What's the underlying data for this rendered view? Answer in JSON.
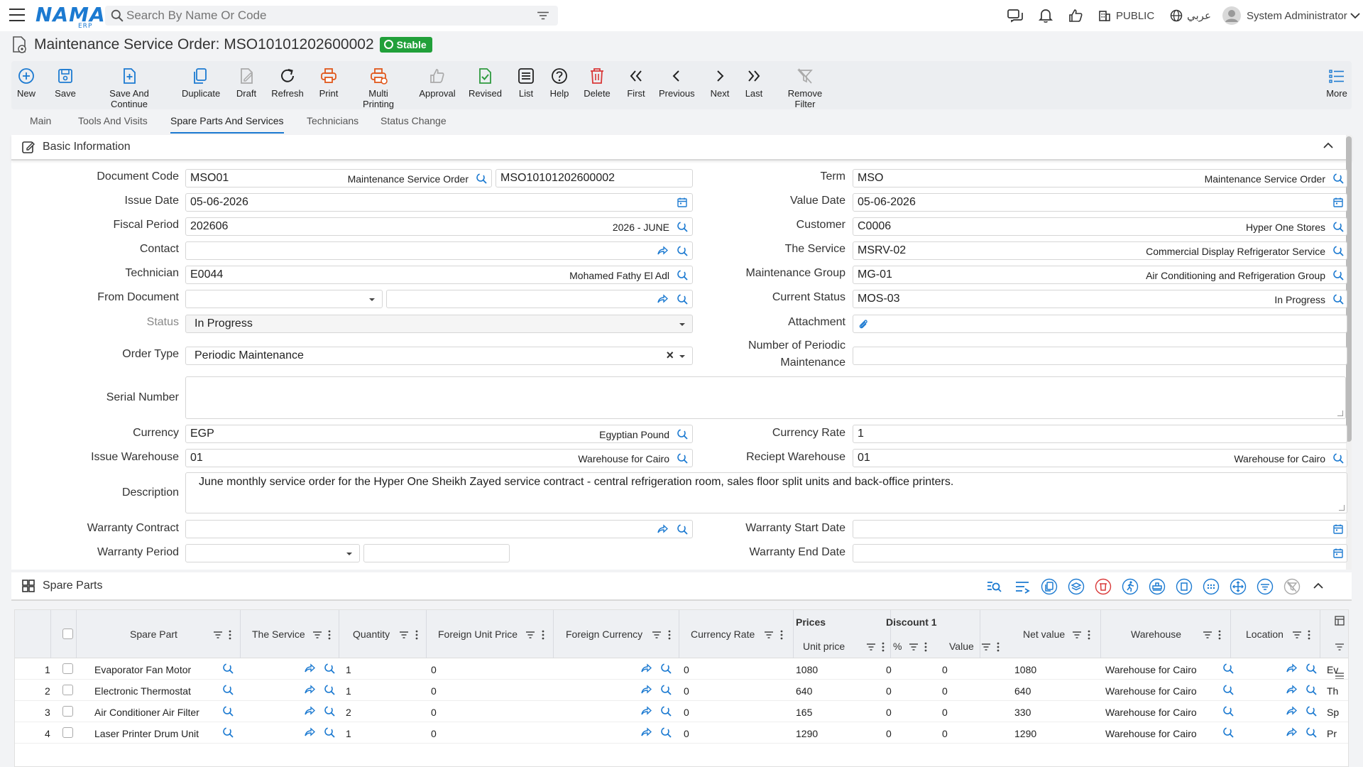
{
  "topbar": {
    "logo": "NAMA",
    "logo_sub": "ERP",
    "search_placeholder": "Search By Name Or Code",
    "public_label": "PUBLIC",
    "language_label": "عربي",
    "user_name": "System Administrator"
  },
  "title": {
    "text": "Maintenance Service Order: MSO10101202600002",
    "status_badge": "Stable"
  },
  "toolbar": {
    "new": "New",
    "save": "Save",
    "save_continue": "Save And Continue",
    "duplicate": "Duplicate",
    "draft": "Draft",
    "refresh": "Refresh",
    "print": "Print",
    "multi_printing": "Multi Printing",
    "approval": "Approval",
    "revised": "Revised",
    "list": "List",
    "help": "Help",
    "delete": "Delete",
    "first": "First",
    "previous": "Previous",
    "next": "Next",
    "last": "Last",
    "remove_filter": "Remove Filter",
    "more": "More"
  },
  "tabs": [
    "Main",
    "Tools And Visits",
    "Spare Parts And Services",
    "Technicians",
    "Status Change"
  ],
  "basic_info": {
    "header": "Basic Information",
    "labels": {
      "document_code": "Document Code",
      "issue_date": "Issue Date",
      "fiscal_period": "Fiscal Period",
      "contact": "Contact",
      "technician": "Technician",
      "from_document": "From Document",
      "status": "Status",
      "order_type": "Order Type",
      "serial_number": "Serial Number",
      "currency": "Currency",
      "issue_warehouse": "Issue Warehouse",
      "description": "Description",
      "warranty_contract": "Warranty Contract",
      "warranty_period": "Warranty Period",
      "term": "Term",
      "value_date": "Value Date",
      "customer": "Customer",
      "the_service": "The Service",
      "maintenance_group": "Maintenance Group",
      "current_status": "Current Status",
      "attachment": "Attachment",
      "num_periodic_1": "Number of Periodic",
      "num_periodic_2": "Maintenance",
      "currency_rate": "Currency Rate",
      "reciept_warehouse": "Reciept Warehouse",
      "warranty_start_date": "Warranty Start Date",
      "warranty_end_date": "Warranty End Date"
    },
    "values": {
      "document_code": "MSO01",
      "document_code_desc": "Maintenance Service Order",
      "document_number": "MSO10101202600002",
      "issue_date": "05-06-2026",
      "fiscal_period": "202606",
      "fiscal_period_desc": "2026 - JUNE",
      "technician": "E0044",
      "technician_desc": "Mohamed Fathy El Adl",
      "status": "In Progress",
      "order_type": "Periodic Maintenance",
      "currency": "EGP",
      "currency_desc": "Egyptian Pound",
      "issue_warehouse": "01",
      "issue_warehouse_desc": "Warehouse for Cairo",
      "description": "June monthly service order for the Hyper One Sheikh Zayed service contract - central refrigeration room, sales floor split units and back-office printers.",
      "term": "MSO",
      "term_desc": "Maintenance Service Order",
      "value_date": "05-06-2026",
      "customer": "C0006",
      "customer_desc": "Hyper One Stores",
      "the_service": "MSRV-02",
      "the_service_desc": "Commercial Display Refrigerator Service",
      "maintenance_group": "MG-01",
      "maintenance_group_desc": "Air Conditioning and Refrigeration Group",
      "current_status": "MOS-03",
      "current_status_desc": "In Progress",
      "currency_rate": "1",
      "reciept_warehouse": "01",
      "reciept_warehouse_desc": "Warehouse for Cairo"
    }
  },
  "spare_parts": {
    "header": "Spare Parts",
    "columns": {
      "spare_part": "Spare Part",
      "the_service": "The Service",
      "quantity": "Quantity",
      "foreign_unit_price": "Foreign Unit Price",
      "foreign_currency": "Foreign Currency",
      "currency_rate": "Currency Rate",
      "prices": "Prices",
      "unit_price": "Unit price",
      "discount1": "Discount 1",
      "pct": "%",
      "value": "Value",
      "net_value": "Net value",
      "warehouse": "Warehouse",
      "location": "Location"
    },
    "rows": [
      {
        "n": "1",
        "part": "Evaporator Fan Motor",
        "qty": "1",
        "fup": "0",
        "rate": "0",
        "unit_price": "1080",
        "pct": "0",
        "value": "0",
        "net": "1080",
        "warehouse": "Warehouse for Cairo",
        "loc": "Ev"
      },
      {
        "n": "2",
        "part": "Electronic Thermostat",
        "qty": "1",
        "fup": "0",
        "rate": "0",
        "unit_price": "640",
        "pct": "0",
        "value": "0",
        "net": "640",
        "warehouse": "Warehouse for Cairo",
        "loc": "Th"
      },
      {
        "n": "3",
        "part": "Air Conditioner Air Filter",
        "qty": "2",
        "fup": "0",
        "rate": "0",
        "unit_price": "165",
        "pct": "0",
        "value": "0",
        "net": "330",
        "warehouse": "Warehouse for Cairo",
        "loc": "Sp"
      },
      {
        "n": "4",
        "part": "Laser Printer Drum Unit",
        "qty": "1",
        "fup": "0",
        "rate": "0",
        "unit_price": "1290",
        "pct": "0",
        "value": "0",
        "net": "1290",
        "warehouse": "Warehouse for Cairo",
        "loc": "Pr"
      }
    ]
  },
  "colors": {
    "accent": "#1c7ad1",
    "stable": "#21a03a",
    "print": "#e0571b",
    "delete": "#d93838",
    "revised": "#2e9a3e"
  }
}
